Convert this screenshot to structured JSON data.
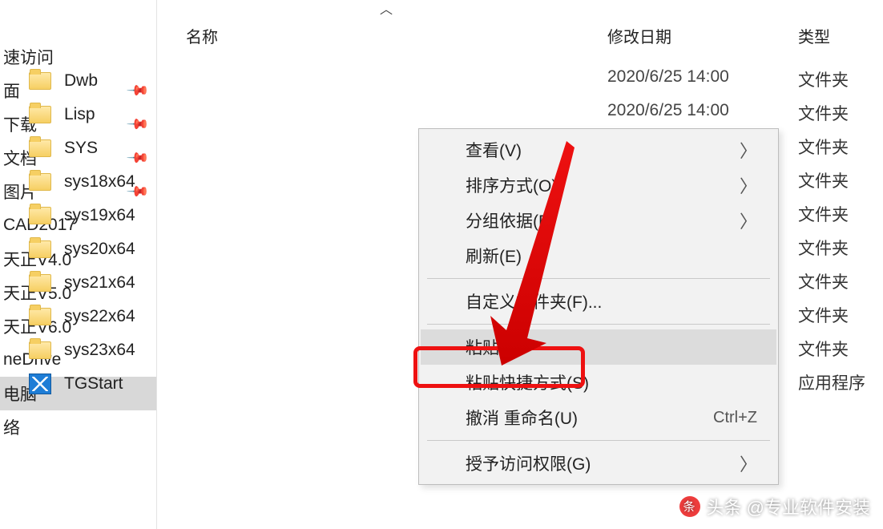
{
  "headers": {
    "name": "名称",
    "date": "修改日期",
    "type": "类型"
  },
  "sidebar": {
    "items": [
      {
        "label": "速访问",
        "pinned": false
      },
      {
        "label": "面",
        "pinned": true
      },
      {
        "label": "下载",
        "pinned": true
      },
      {
        "label": "文档",
        "pinned": true
      },
      {
        "label": "图片",
        "pinned": true
      },
      {
        "label": "CAD2017",
        "pinned": false
      },
      {
        "label": "天正V4.0",
        "pinned": false
      },
      {
        "label": "天正V5.0",
        "pinned": false
      },
      {
        "label": "天正V6.0",
        "pinned": false
      },
      {
        "label": "neDrive",
        "pinned": false
      },
      {
        "label": "电脑",
        "pinned": false,
        "selected": true
      },
      {
        "label": "络",
        "pinned": false
      }
    ]
  },
  "files": [
    {
      "name": "Dwb",
      "date": "2020/6/25 14:00",
      "type": "文件夹",
      "kind": "folder"
    },
    {
      "name": "Lisp",
      "date": "2020/6/25 14:00",
      "type": "文件夹",
      "kind": "folder"
    },
    {
      "name": "SYS",
      "date": "",
      "type": "文件夹",
      "kind": "folder"
    },
    {
      "name": "sys18x64",
      "date": "",
      "type": "文件夹",
      "kind": "folder"
    },
    {
      "name": "sys19x64",
      "date": "",
      "type": "文件夹",
      "kind": "folder"
    },
    {
      "name": "sys20x64",
      "date": "",
      "type": "文件夹",
      "kind": "folder"
    },
    {
      "name": "sys21x64",
      "date": "",
      "type": "文件夹",
      "kind": "folder"
    },
    {
      "name": "sys22x64",
      "date": "",
      "type": "文件夹",
      "kind": "folder"
    },
    {
      "name": "sys23x64",
      "date": "",
      "type": "文件夹",
      "kind": "folder"
    },
    {
      "name": "TGStart",
      "date": "",
      "type": "应用程序",
      "kind": "app"
    }
  ],
  "contextMenu": {
    "groups": [
      [
        {
          "label": "查看(V)",
          "submenu": true
        },
        {
          "label": "排序方式(O)",
          "submenu": true
        },
        {
          "label": "分组依据(P)",
          "submenu": true
        },
        {
          "label": "刷新(E)"
        }
      ],
      [
        {
          "label": "自定义文件夹(F)..."
        }
      ],
      [
        {
          "label": "粘贴(P)",
          "highlight": true
        },
        {
          "label": "粘贴快捷方式(S)"
        },
        {
          "label": "撤消 重命名(U)",
          "shortcut": "Ctrl+Z"
        }
      ],
      [
        {
          "label": "授予访问权限(G)",
          "submenu": true
        }
      ]
    ]
  },
  "watermark": "头条 @专业软件安装"
}
